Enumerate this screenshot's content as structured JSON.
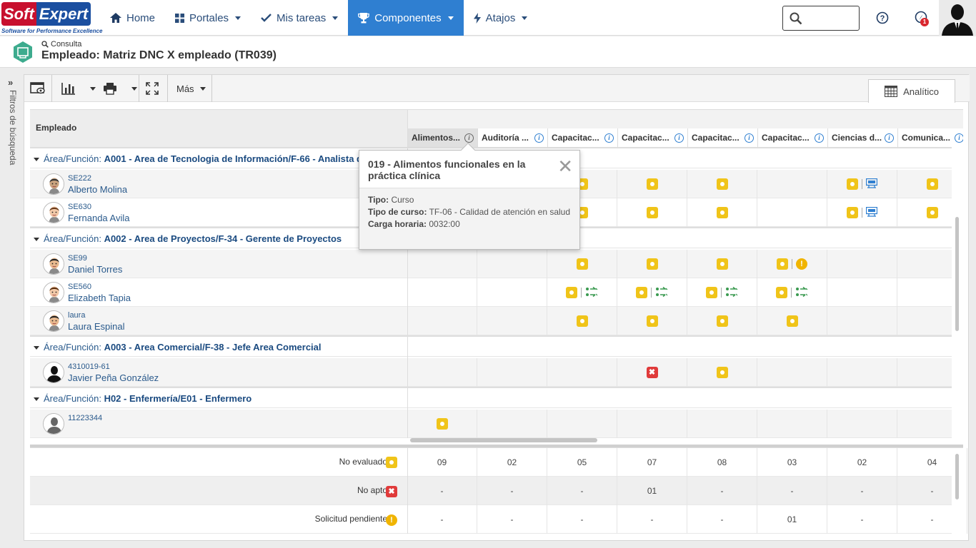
{
  "logo": {
    "soft": "Soft",
    "expert": "Expert",
    "tagline": "Software for Performance Excellence"
  },
  "nav": [
    {
      "label": "Home",
      "icon": "home-icon"
    },
    {
      "label": "Portales",
      "icon": "grid-icon"
    },
    {
      "label": "Mis tareas",
      "icon": "check-icon"
    },
    {
      "label": "Componentes",
      "icon": "trophy-icon",
      "active": true
    },
    {
      "label": "Atajos",
      "icon": "bolt-icon"
    }
  ],
  "search": {
    "value": "",
    "placeholder": ""
  },
  "notifications": {
    "count": "1"
  },
  "page": {
    "mode": "Consulta",
    "title": "Empleado: Matriz DNC X empleado (TR039)"
  },
  "filters_label": "Filtros de búsqueda",
  "toolbar": {
    "more": "Más",
    "view_tab": "Analítico"
  },
  "grid": {
    "employee_header": "Empleado",
    "columns": [
      "Alimentos...",
      "Auditoría ...",
      "Capacitac...",
      "Capacitac...",
      "Capacitac...",
      "Capacitac...",
      "Ciencias d...",
      "Comunica..."
    ],
    "group_prefix": "Área/Función:",
    "groups": [
      {
        "name": "A001 - Area de Tecnologia de Información/F-66 - Analista de sistemas",
        "rows": [
          {
            "code": "SE222",
            "name": "Alberto Molina",
            "cells": [
              "",
              "",
              "Y",
              "Y",
              "Y",
              "",
              "YT",
              "Y"
            ]
          },
          {
            "code": "SE630",
            "name": "Fernanda Avila",
            "cells": [
              "",
              "",
              "Y",
              "Y",
              "Y",
              "",
              "YT",
              "Y"
            ]
          }
        ]
      },
      {
        "name": "A002 - Area de Proyectos/F-34 - Gerente de Proyectos",
        "rows": [
          {
            "code": "SE99",
            "name": "Daniel Torres",
            "cells": [
              "",
              "",
              "Y",
              "Y",
              "Y",
              "YW",
              "",
              ""
            ]
          },
          {
            "code": "SE560",
            "name": "Elizabeth Tapia",
            "cells": [
              "",
              "",
              "YG",
              "YG",
              "YG",
              "YG",
              "",
              ""
            ]
          },
          {
            "code": "laura",
            "name": "Laura Espinal",
            "cells": [
              "",
              "",
              "Y",
              "Y",
              "Y",
              "Y",
              "",
              ""
            ]
          }
        ]
      },
      {
        "name": "A003 - Area Comercial/F-38 - Jefe Area Comercial",
        "rows": [
          {
            "code": "4310019-61",
            "name": "Javier Peña González",
            "cells": [
              "",
              "",
              "",
              "R",
              "Y",
              "",
              "",
              ""
            ]
          }
        ]
      },
      {
        "name": "H02 - Enfermería/E01 - Enfermero",
        "rows": [
          {
            "code": "11223344",
            "name": "",
            "cells": [
              "Y",
              "",
              "",
              "",
              "",
              "",
              "",
              ""
            ]
          }
        ]
      }
    ]
  },
  "tooltip": {
    "title": "019 - Alimentos funcionales en la práctica clínica",
    "tipo_label": "Tipo:",
    "tipo": "Curso",
    "tipo_curso_label": "Tipo de curso:",
    "tipo_curso": "TF-06 - Calidad de atención en salud",
    "carga_label": "Carga horaria:",
    "carga": "0032:00"
  },
  "summary": [
    {
      "label": "No evaluado",
      "icon": "Y",
      "values": [
        "09",
        "02",
        "05",
        "07",
        "08",
        "03",
        "02",
        "04"
      ]
    },
    {
      "label": "No apto",
      "icon": "R",
      "values": [
        "-",
        "-",
        "-",
        "01",
        "-",
        "-",
        "-",
        "-"
      ]
    },
    {
      "label": "Solicitud pendiente",
      "icon": "W",
      "values": [
        "-",
        "-",
        "-",
        "-",
        "-",
        "01",
        "-",
        "-"
      ]
    }
  ],
  "colors": {
    "accent": "#2f7fd1",
    "link": "#2a5a8c",
    "pending": "#f0c419",
    "fail": "#e03a3a"
  }
}
